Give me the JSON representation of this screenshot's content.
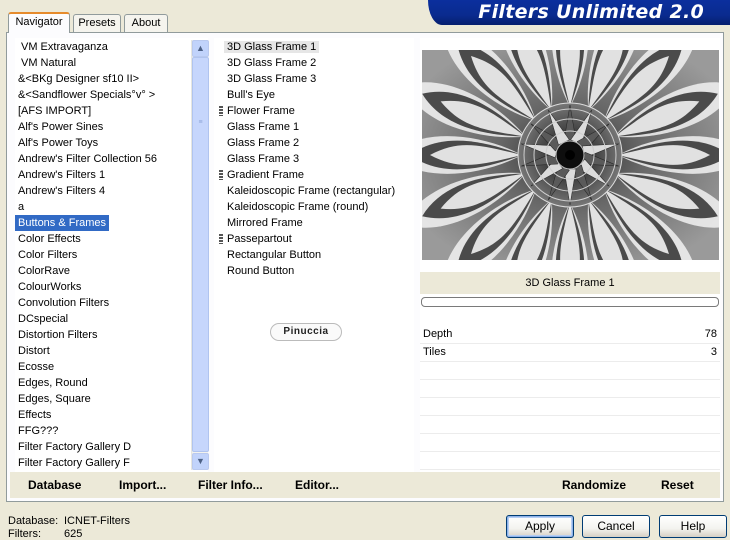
{
  "window": {
    "title": "Filters Unlimited 2.0"
  },
  "tabs": [
    {
      "label": "Navigator",
      "active": true
    },
    {
      "label": "Presets",
      "active": false
    },
    {
      "label": "About",
      "active": false
    }
  ],
  "categories": {
    "items": [
      "VM Extravaganza",
      "VM Natural",
      "&<BKg Designer sf10 II>",
      "&<Sandflower Specials°v° >",
      "[AFS IMPORT]",
      "Alf's Power Sines",
      "Alf's Power Toys",
      "Andrew's Filter Collection 56",
      "Andrew's Filters 1",
      "Andrew's Filters 4",
      "a",
      "Buttons & Frames",
      "Color Effects",
      "Color Filters",
      "ColorRave",
      "ColourWorks",
      "Convolution Filters",
      "DCspecial",
      "Distortion Filters",
      "Distort",
      "Ecosse",
      "Edges, Round",
      "Edges, Square",
      "Effects",
      "FFG???",
      "Filter Factory Gallery D",
      "Filter Factory Gallery F"
    ],
    "selected_index": 11
  },
  "filters": {
    "items": [
      {
        "label": "3D Glass Frame 1",
        "group": false
      },
      {
        "label": "3D Glass Frame 2",
        "group": false
      },
      {
        "label": "3D Glass Frame 3",
        "group": false
      },
      {
        "label": "Bull's Eye",
        "group": false
      },
      {
        "label": "Flower Frame",
        "group": true
      },
      {
        "label": "Glass Frame 1",
        "group": false
      },
      {
        "label": "Glass Frame 2",
        "group": false
      },
      {
        "label": "Glass Frame 3",
        "group": false
      },
      {
        "label": "Gradient Frame",
        "group": true
      },
      {
        "label": "Kaleidoscopic Frame (rectangular)",
        "group": false
      },
      {
        "label": "Kaleidoscopic Frame (round)",
        "group": false
      },
      {
        "label": "Mirrored Frame",
        "group": false
      },
      {
        "label": "Passepartout",
        "group": true
      },
      {
        "label": "Rectangular Button",
        "group": false
      },
      {
        "label": "Round Button",
        "group": false
      }
    ],
    "selected_index": 0
  },
  "logo_text": "Pinuccia",
  "preview": {
    "filter_name": "3D Glass Frame 1",
    "progress": 0
  },
  "parameters": [
    {
      "name": "Depth",
      "value": "78"
    },
    {
      "name": "Tiles",
      "value": "3"
    }
  ],
  "toolbar": {
    "database": "Database",
    "import": "Import...",
    "filter_info": "Filter Info...",
    "editor": "Editor...",
    "randomize": "Randomize",
    "reset": "Reset"
  },
  "status": {
    "database_label": "Database:",
    "database_value": "ICNET-Filters",
    "filters_label": "Filters:",
    "filters_value": "625"
  },
  "buttons": {
    "apply": "Apply",
    "cancel": "Cancel",
    "help": "Help"
  },
  "icons": {
    "scroll_up": "chevron-up-icon",
    "scroll_down": "chevron-down-icon",
    "group": "group-marker-icon"
  }
}
